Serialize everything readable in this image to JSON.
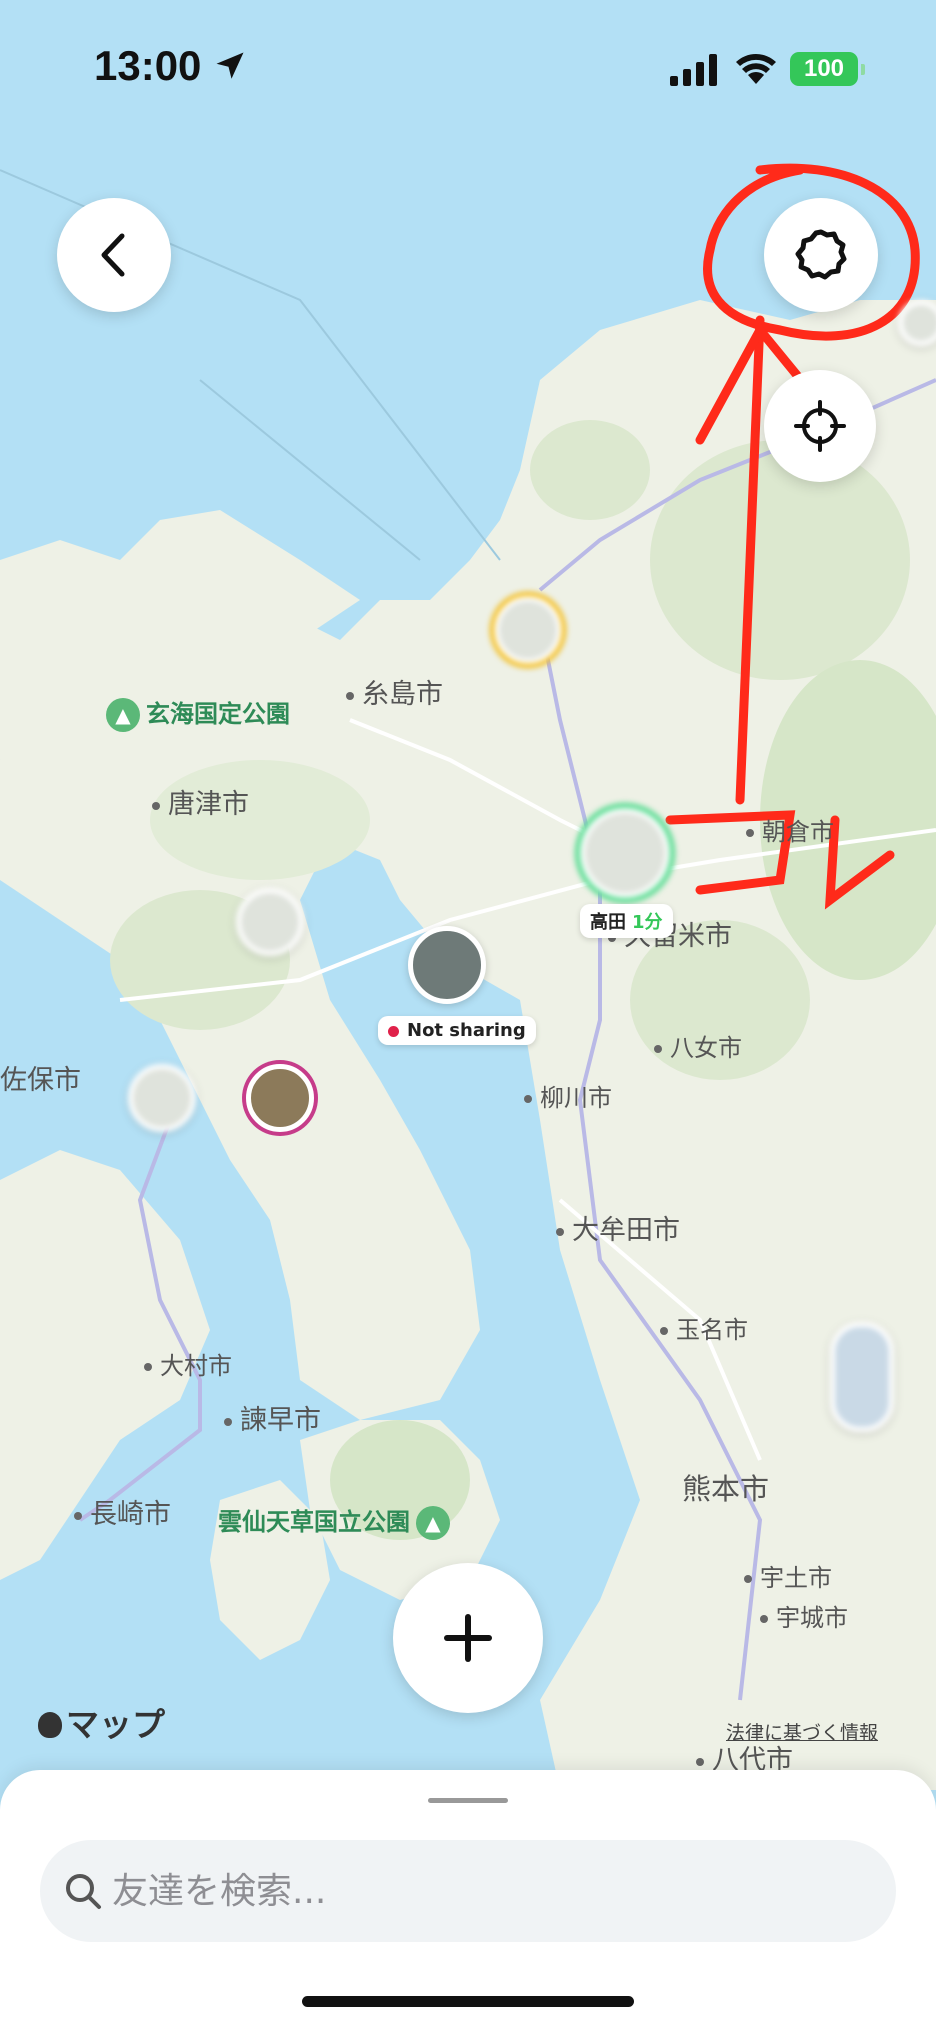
{
  "status_bar": {
    "time": "13:00",
    "battery": "100"
  },
  "map": {
    "places": [
      {
        "id": "itoshima",
        "label": "糸島市"
      },
      {
        "id": "genkai",
        "label": "玄海国定公園"
      },
      {
        "id": "karatsu",
        "label": "唐津市"
      },
      {
        "id": "asakura",
        "label": "朝倉市"
      },
      {
        "id": "kurume",
        "label": "久留米市"
      },
      {
        "id": "yame",
        "label": "八女市"
      },
      {
        "id": "yanagawa",
        "label": "柳川市"
      },
      {
        "id": "sasebo",
        "label": "佐保市"
      },
      {
        "id": "omuta",
        "label": "大牟田市"
      },
      {
        "id": "tamana",
        "label": "玉名市"
      },
      {
        "id": "omura",
        "label": "大村市"
      },
      {
        "id": "isahaya",
        "label": "諫早市"
      },
      {
        "id": "nagasaki",
        "label": "長崎市"
      },
      {
        "id": "unzen",
        "label": "雲仙天草国立公園"
      },
      {
        "id": "kumamoto",
        "label": "熊本市"
      },
      {
        "id": "uto",
        "label": "宇土市"
      },
      {
        "id": "uki",
        "label": "宇城市"
      },
      {
        "id": "yatsushiro",
        "label": "八代市"
      }
    ],
    "friend_pill": {
      "name": "高田",
      "time": "1分"
    },
    "not_sharing_pill": "Not sharing",
    "attribution": "マップ",
    "legal": "法律に基づく情報"
  },
  "annotation": {
    "text": "コレ",
    "color": "#ff2a1a"
  },
  "search": {
    "placeholder": "友達を検索..."
  },
  "colors": {
    "water": "#b3e0f5",
    "land": "#eef1e6",
    "green": "#34c759",
    "red_dot": "#e0214a"
  }
}
